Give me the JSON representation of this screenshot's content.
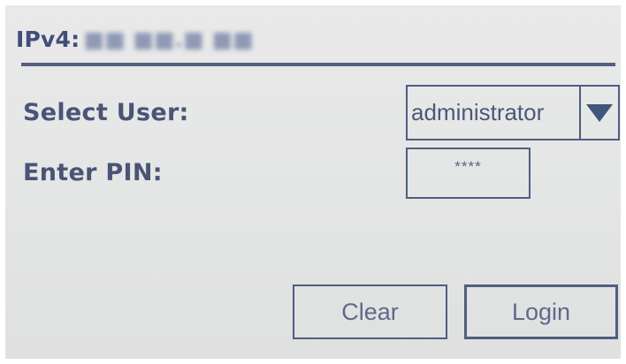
{
  "header": {
    "ip_label": "IPv4:",
    "ip_value": "■■ ■■.■ ■■"
  },
  "form": {
    "user_label": "Select User:",
    "user_selected": "administrator",
    "pin_label": "Enter PIN:",
    "pin_value": "****"
  },
  "buttons": {
    "clear_label": "Clear",
    "login_label": "Login"
  },
  "icons": {
    "dropdown": "triangle-down-icon"
  },
  "colors": {
    "text_accent": "#4a5476",
    "border": "#4f5e80",
    "background": "#e5e6e6",
    "arrow": "#40557b"
  }
}
